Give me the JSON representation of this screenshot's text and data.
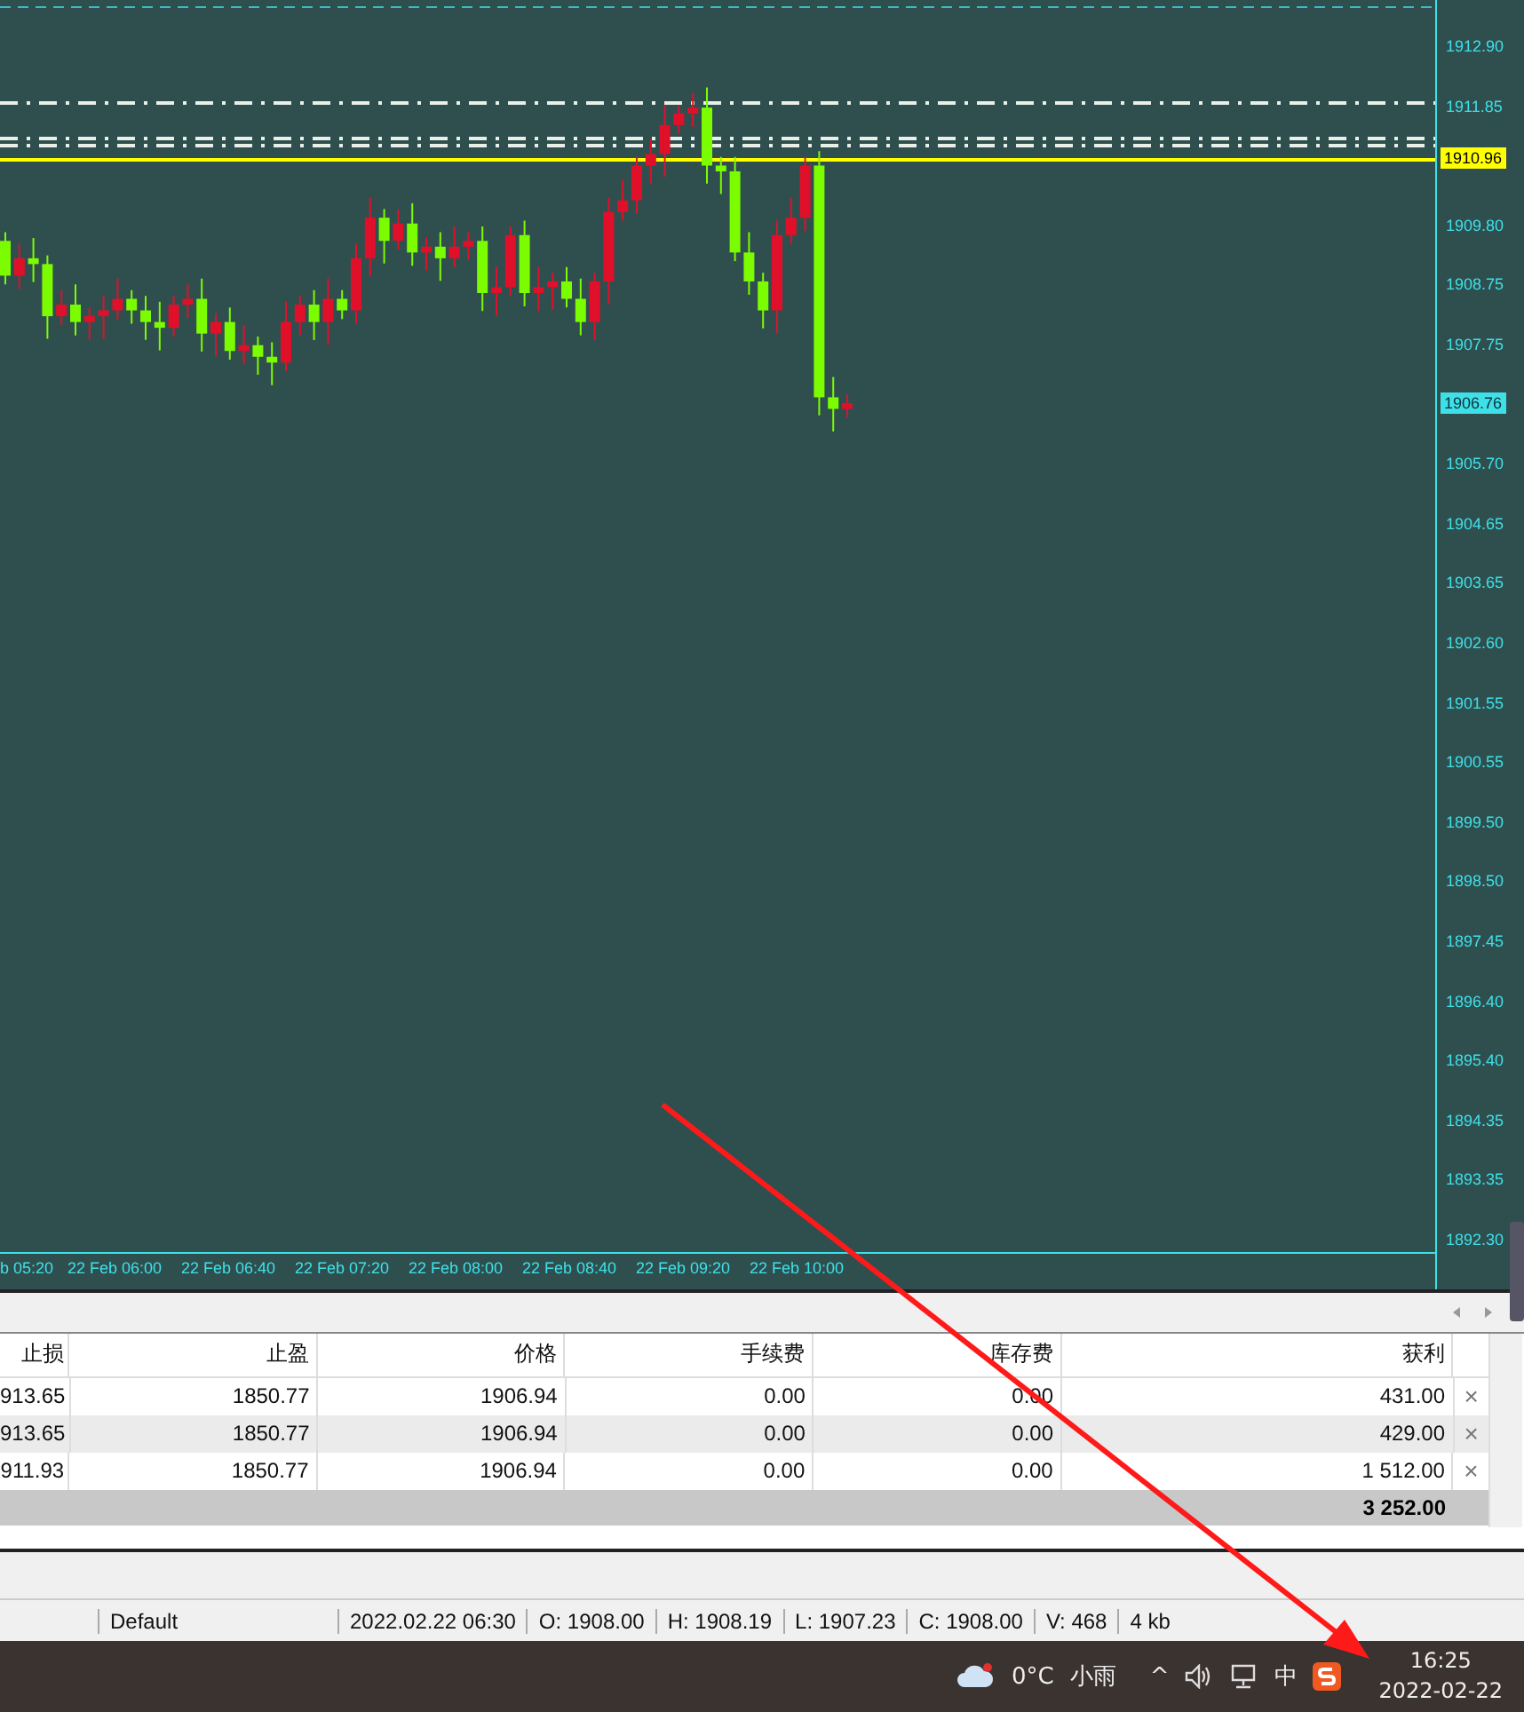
{
  "chart": {
    "price_axis": {
      "labels": [
        "1912.90",
        "1911.85",
        "1909.80",
        "1908.75",
        "1907.75",
        "1905.70",
        "1904.65",
        "1903.65",
        "1902.60",
        "1901.55",
        "1900.55",
        "1899.50",
        "1898.50",
        "1897.45",
        "1896.40",
        "1895.40",
        "1894.35",
        "1893.35",
        "1892.30"
      ]
    },
    "price_tags": [
      {
        "kind": "line",
        "text": "1910.96"
      },
      {
        "kind": "bid",
        "text": "1906.76"
      }
    ],
    "time_axis": {
      "labels": [
        "b 05:20",
        "22 Feb 06:00",
        "22 Feb 06:40",
        "22 Feb 07:20",
        "22 Feb 08:00",
        "22 Feb 08:40",
        "22 Feb 09:20",
        "22 Feb 10:00"
      ]
    }
  },
  "table": {
    "columns": [
      "止损",
      "止盈",
      "价格",
      "手续费",
      "库存费",
      "获利"
    ],
    "rows": [
      [
        "913.65",
        "1850.77",
        "1906.94",
        "0.00",
        "0.00",
        "431.00"
      ],
      [
        "913.65",
        "1850.77",
        "1906.94",
        "0.00",
        "0.00",
        "429.00"
      ],
      [
        "911.93",
        "1850.77",
        "1906.94",
        "0.00",
        "0.00",
        "1 512.00"
      ]
    ],
    "close_mark": "×",
    "total": "3 252.00"
  },
  "status_bar": [
    "Default",
    "2022.02.22 06:30",
    "O: 1908.00",
    "H: 1908.19",
    "L: 1907.23",
    "C: 1908.00",
    "V: 468",
    "4 kb"
  ],
  "taskbar": {
    "temperature": "0°C",
    "weather": "小雨",
    "chevron": "^",
    "ime": "中",
    "time": "16:25",
    "date": "2022-02-22"
  }
}
